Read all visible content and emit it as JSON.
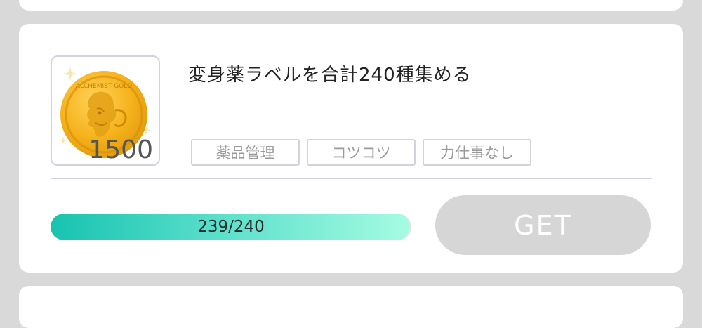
{
  "mission": {
    "title": "変身薬ラベルを合計240種集める",
    "reward": {
      "amount": "1500",
      "icon": "gold-coin-icon",
      "coin_engraving": "ALCHEMIST GOLD"
    },
    "tags": [
      "薬品管理",
      "コツコツ",
      "力仕事なし"
    ],
    "progress": {
      "text": "239/240",
      "current": 239,
      "total": 240
    },
    "get_button": {
      "label": "GET",
      "enabled": false
    }
  },
  "colors": {
    "background": "#d9d9d9",
    "card": "#ffffff",
    "border": "#d0d3de",
    "progress_start": "#17c3b0",
    "progress_end": "#a6fbe2",
    "button_disabled": "#d6d6d6",
    "coin": "#f5b21b"
  }
}
